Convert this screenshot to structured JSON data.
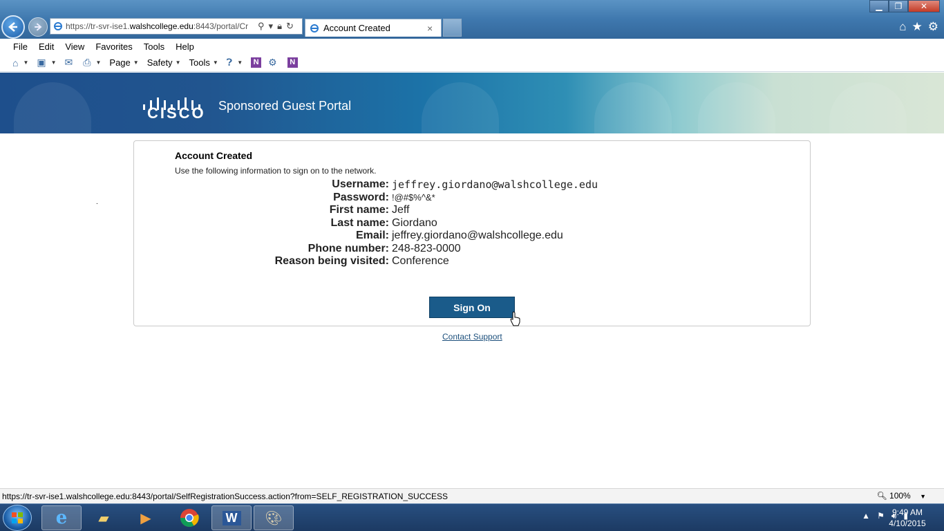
{
  "browser": {
    "address_prefix": "https://tr-svr-ise1.",
    "address_domain": "walshcollege.edu",
    "address_suffix": ":8443/portal/Cr",
    "tab_title": "Account Created",
    "tab_close": "×"
  },
  "menu": {
    "file": "File",
    "edit": "Edit",
    "view": "View",
    "favorites": "Favorites",
    "tools": "Tools",
    "help": "Help"
  },
  "commandbar": {
    "page": "Page",
    "safety": "Safety",
    "tools": "Tools"
  },
  "banner": {
    "brand": "CISCO",
    "title": "Sponsored Guest Portal"
  },
  "account": {
    "heading": "Account Created",
    "intro": "Use the following information to sign on to the network.",
    "fields": [
      {
        "label": "Username:",
        "value": "jeffrey.giordano@walshcollege.edu"
      },
      {
        "label": "Password:",
        "value": "!@#$%^&*"
      },
      {
        "label": "First name:",
        "value": "Jeff"
      },
      {
        "label": "Last name:",
        "value": "Giordano"
      },
      {
        "label": "Email:",
        "value": "jeffrey.giordano@walshcollege.edu"
      },
      {
        "label": "Phone number:",
        "value": "248-823-0000"
      },
      {
        "label": "Reason being visited:",
        "value": "Conference"
      }
    ],
    "signon_label": "Sign On",
    "contact_label": "Contact Support"
  },
  "status": {
    "url": "https://tr-svr-ise1.walshcollege.edu:8443/portal/SelfRegistrationSuccess.action?from=SELF_REGISTRATION_SUCCESS",
    "zoom": "100%"
  },
  "taskbar": {
    "time": "9:49 AM",
    "date": "4/10/2015"
  }
}
